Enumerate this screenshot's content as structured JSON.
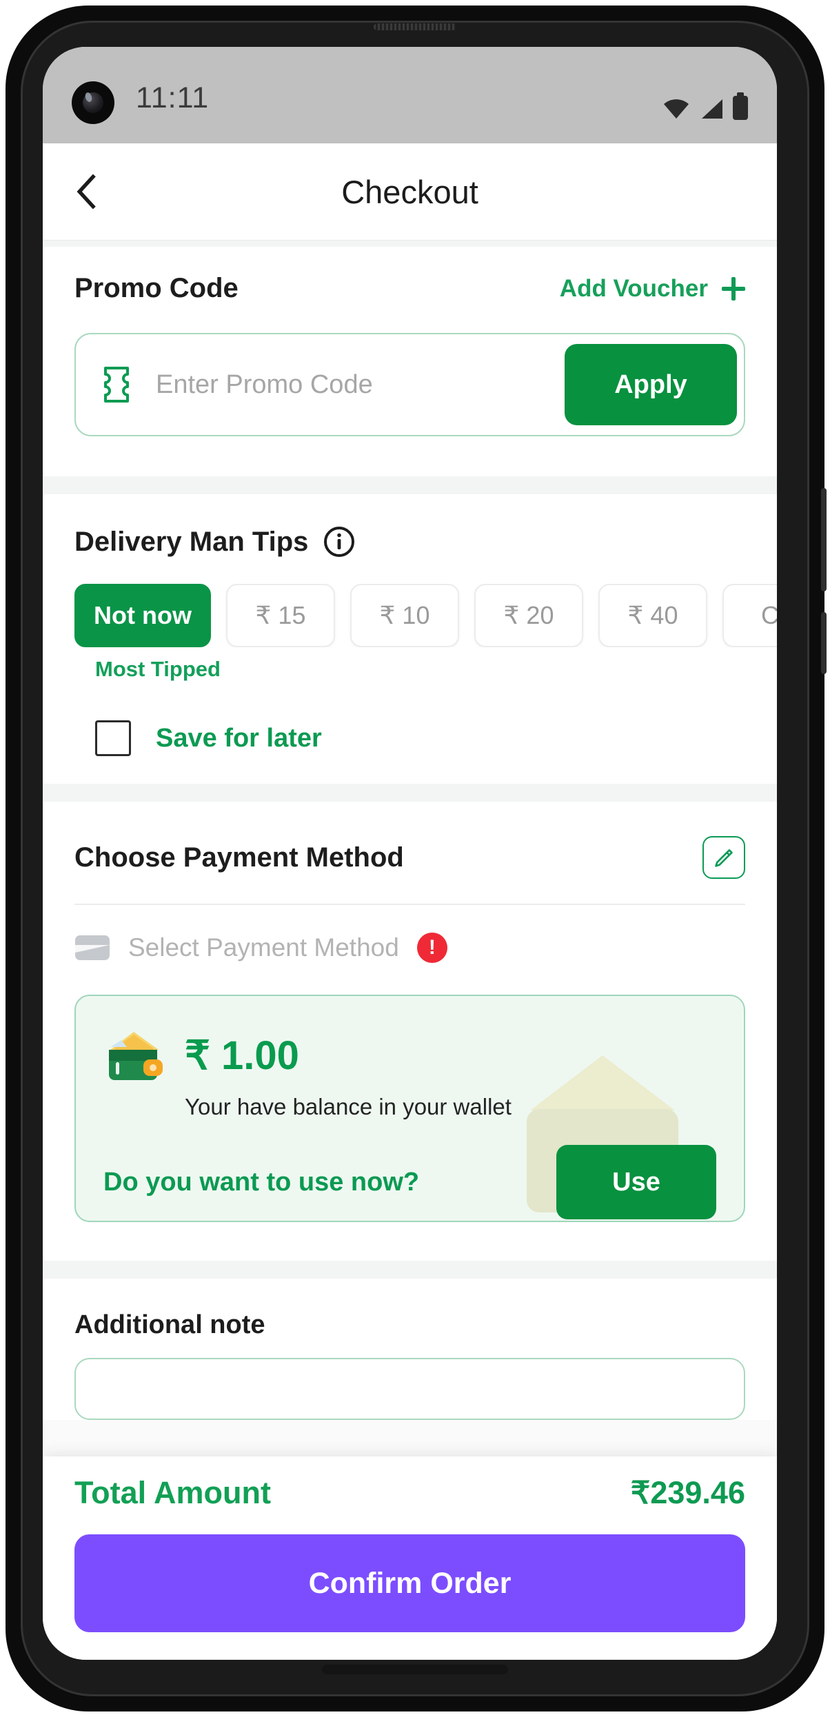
{
  "status_bar": {
    "time": "11:11",
    "icons": [
      "wifi-icon",
      "cellular-signal-icon",
      "battery-icon"
    ]
  },
  "appbar": {
    "back_icon": "chevron-left-icon",
    "title": "Checkout"
  },
  "promo": {
    "title": "Promo Code",
    "add_voucher_label": "Add Voucher",
    "add_voucher_icon": "plus-icon",
    "field_icon": "ticket-icon",
    "input_value": "",
    "input_placeholder": "Enter Promo Code",
    "apply_label": "Apply"
  },
  "tips": {
    "title": "Delivery Man Tips",
    "info_icon": "info-circle-icon",
    "chips": [
      {
        "label": "Not now",
        "selected": true,
        "badge": ""
      },
      {
        "label": "₹ 15",
        "selected": false,
        "badge": "Most Tipped"
      },
      {
        "label": "₹ 10",
        "selected": false,
        "badge": ""
      },
      {
        "label": "₹ 20",
        "selected": false,
        "badge": ""
      },
      {
        "label": "₹ 40",
        "selected": false,
        "badge": ""
      },
      {
        "label": "Cu",
        "selected": false,
        "badge": ""
      }
    ],
    "most_tipped_label": "Most Tipped",
    "save_for_later_label": "Save for later",
    "save_for_later_checked": false
  },
  "payment": {
    "title": "Choose Payment Method",
    "edit_icon": "pencil-edit-icon",
    "card_icon": "credit-card-icon",
    "select_label": "Select Payment Method",
    "error_icon": "exclamation-icon",
    "error_mark": "!"
  },
  "wallet": {
    "icon": "wallet-icon",
    "amount": "₹ 1.00",
    "subtitle": "Your have balance in your wallet",
    "question": "Do you want to use now?",
    "use_label": "Use"
  },
  "note": {
    "title": "Additional note",
    "placeholder": ""
  },
  "footer": {
    "total_label": "Total Amount",
    "total_value": "₹239.46",
    "confirm_label": "Confirm Order"
  },
  "colors": {
    "primary_green": "#08913f",
    "accent_green": "#12a055",
    "confirm_purple": "#7c4dff",
    "error_red": "#ef2a36",
    "wallet_bg": "#eef8f1"
  }
}
